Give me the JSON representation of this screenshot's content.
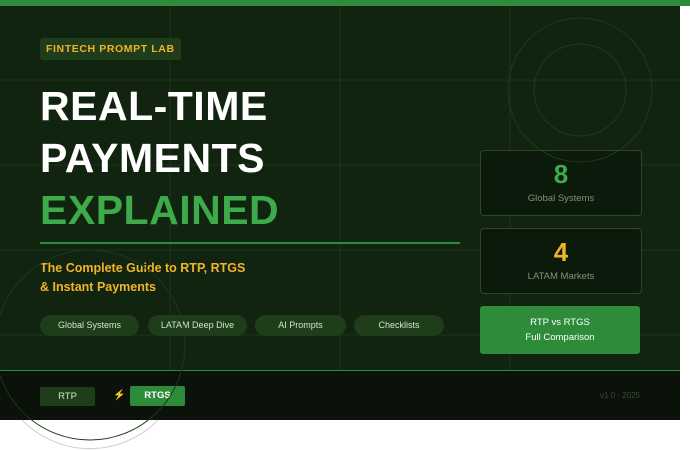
{
  "brand_tag": "FINTECH PROMPT LAB",
  "headline": {
    "line1": "REAL-TIME",
    "line2": "PAYMENTS",
    "line3": "EXPLAINED"
  },
  "subtitle": {
    "line1": "The Complete Guide to RTP, RTGS",
    "line2": "& Instant Payments"
  },
  "topic_pills": [
    "Global Systems",
    "LATAM Deep Dive",
    "AI Prompts",
    "Checklists"
  ],
  "stats": [
    {
      "value": "8",
      "label": "Global Systems",
      "color": "#3dab4a"
    },
    {
      "value": "4",
      "label": "LATAM Markets",
      "color": "#f0b429"
    }
  ],
  "comparison_button": {
    "line1": "RTP vs RTGS",
    "line2": "Full Comparison"
  },
  "footer": {
    "rtp_label": "RTP",
    "bolt_icon": "⚡",
    "rtgs_label": "RTGS",
    "version": "v1.0 · 2025"
  },
  "colors": {
    "accent_green": "#2e8b3a",
    "bright_green": "#3dab4a",
    "amber": "#f0b429",
    "background": "#11240f"
  }
}
